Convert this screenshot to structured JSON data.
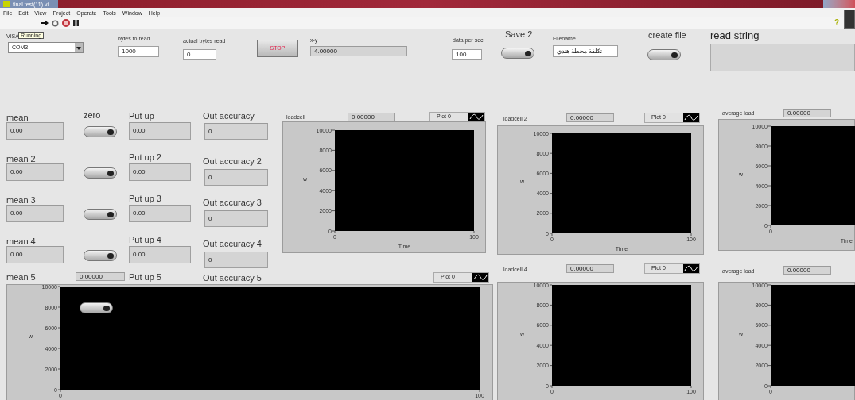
{
  "window": {
    "title": "final test(11).vi"
  },
  "menu": [
    "File",
    "Edit",
    "View",
    "Project",
    "Operate",
    "Tools",
    "Window",
    "Help"
  ],
  "toolbar_help": "?",
  "header": {
    "visa": {
      "label": "VISA",
      "tag": "Running",
      "value": "COM3"
    },
    "bytes_to_read": {
      "label": "bytes to read",
      "value": "1000"
    },
    "actual_bytes_read": {
      "label": "actual bytes read",
      "value": "0"
    },
    "stop": "STOP",
    "xy": {
      "label": "x-y",
      "value": "4.00000"
    },
    "data_per_sec": {
      "label": "data per sec",
      "value": "100"
    },
    "save": {
      "label": "Save 2",
      "on": false
    },
    "filename": {
      "label": "Filename",
      "value": "تكلفة محطة هندي"
    },
    "create_file": {
      "label": "create file",
      "on": false
    },
    "read_string": {
      "label": "read string"
    }
  },
  "channels": [
    {
      "mean_label": "mean",
      "mean": "0.00",
      "zero_label": "zero",
      "zero_on": false,
      "put_up_label": "Put up",
      "put_up": "0.00",
      "accuracy_label": "Out accuracy",
      "accuracy": "0"
    },
    {
      "mean_label": "mean 2",
      "mean": "0.00",
      "zero_on": false,
      "put_up_label": "Put up 2",
      "put_up": "0.00",
      "accuracy_label": "Out accuracy 2",
      "accuracy": "0"
    },
    {
      "mean_label": "mean 3",
      "mean": "0.00",
      "zero_on": false,
      "put_up_label": "Put up 3",
      "put_up": "0.00",
      "accuracy_label": "Out accuracy 3",
      "accuracy": "0"
    },
    {
      "mean_label": "mean 4",
      "mean": "0.00",
      "zero_on": false,
      "put_up_label": "Put up 4",
      "put_up": "0.00",
      "accuracy_label": "Out accuracy 4",
      "accuracy": "0"
    }
  ],
  "row5": {
    "mean_label": "mean 5",
    "value": "0.00000",
    "put_up_label": "Put up 5",
    "accuracy_label": "Out accuracy 5"
  },
  "charts": [
    {
      "label": "loadcell",
      "value": "0.00000",
      "legend": "Plot 0",
      "ylabel": "w",
      "xlabel": "Time",
      "y_scale": [
        "10000",
        "8000",
        "6000",
        "4000",
        "2000",
        "0"
      ],
      "x_scale": [
        "0",
        "100"
      ]
    },
    {
      "label": "loadcell 2",
      "value": "0.00000",
      "legend": "Plot 0",
      "ylabel": "w",
      "xlabel": "Time",
      "y_scale": [
        "10000",
        "8000",
        "6000",
        "4000",
        "2000",
        "0"
      ],
      "x_scale": [
        "0",
        "100"
      ]
    },
    {
      "label": "average load",
      "value": "0.00000",
      "ylabel": "w",
      "xlabel": "Time",
      "y_scale": [
        "10000",
        "8000",
        "6000",
        "4000",
        "2000",
        "0"
      ],
      "x_scale": [
        "0"
      ]
    },
    {
      "legend": "Plot 0",
      "ylabel": "w",
      "y_scale": [
        "10000",
        "8000",
        "6000",
        "4000",
        "2000",
        "0"
      ],
      "x_scale": [
        "0",
        "100"
      ]
    },
    {
      "label": "loadcell 4",
      "value": "0.00000",
      "legend": "Plot 0",
      "ylabel": "w",
      "y_scale": [
        "10000",
        "8000",
        "6000",
        "4000",
        "2000",
        "0"
      ],
      "x_scale": [
        "0",
        "100"
      ]
    },
    {
      "label": "average load",
      "value": "0.00000",
      "ylabel": "w",
      "y_scale": [
        "10000",
        "8000",
        "6000",
        "4000",
        "2000",
        "0"
      ],
      "x_scale": [
        "0"
      ]
    }
  ],
  "overlay_switch": {
    "on": false
  }
}
